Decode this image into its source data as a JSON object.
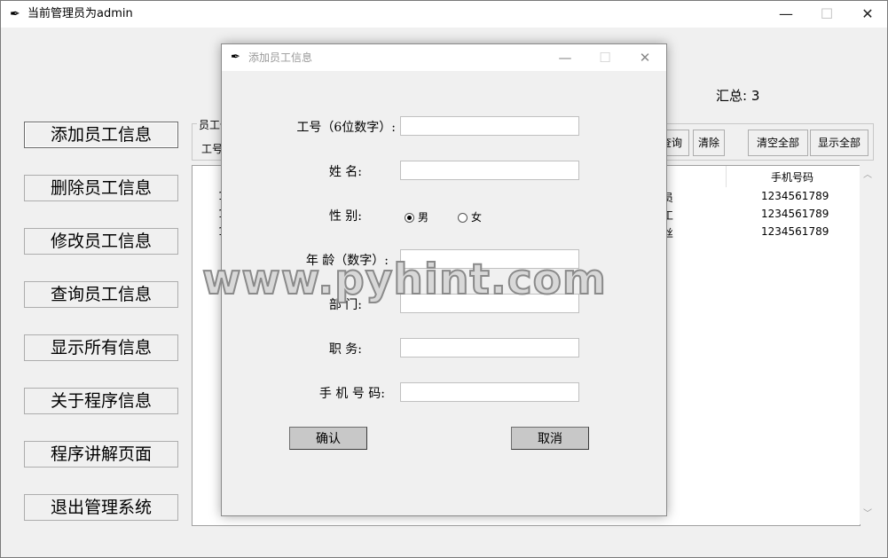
{
  "main_window": {
    "title": "当前管理员为admin",
    "controls": {
      "minimize": "—",
      "maximize": "☐",
      "close": "✕"
    }
  },
  "sidebar": {
    "items": [
      {
        "label": "添加员工信息"
      },
      {
        "label": "删除员工信息"
      },
      {
        "label": "修改员工信息"
      },
      {
        "label": "查询员工信息"
      },
      {
        "label": "显示所有信息"
      },
      {
        "label": "关于程序信息"
      },
      {
        "label": "程序讲解页面"
      },
      {
        "label": "退出管理系统"
      }
    ]
  },
  "summary": {
    "text": "汇总: 3"
  },
  "search_group": {
    "legend_fragment": "员工信",
    "field_fragment": "工号",
    "query_label": "查询",
    "clear_label": "清除",
    "clear_all_label": "清空全部",
    "show_all_label": "显示全部"
  },
  "table": {
    "phone_header": "手机号码",
    "rows": [
      {
        "id_fragment": "1",
        "mid_fragment": "员",
        "phone": "1234561789"
      },
      {
        "id_fragment": "1",
        "mid_fragment": "工",
        "phone": "1234561789"
      },
      {
        "id_fragment": "1",
        "mid_fragment": "丝",
        "phone": "1234561789"
      }
    ]
  },
  "dialog": {
    "title": "添加员工信息",
    "controls": {
      "minimize": "—",
      "maximize": "☐",
      "close": "✕"
    },
    "fields": {
      "id_label": "工号（6位数字）:",
      "name_label": "姓  名:",
      "gender_label": "性  别:",
      "age_label": "年 龄（数字）:",
      "dept_label": "部  门:",
      "position_label": "职  务:",
      "phone_label": "手 机 号 码:"
    },
    "gender_options": [
      {
        "label": "男",
        "selected": true
      },
      {
        "label": "女",
        "selected": false
      }
    ],
    "confirm_label": "确认",
    "cancel_label": "取消"
  },
  "watermark": "www.pyhint.com"
}
